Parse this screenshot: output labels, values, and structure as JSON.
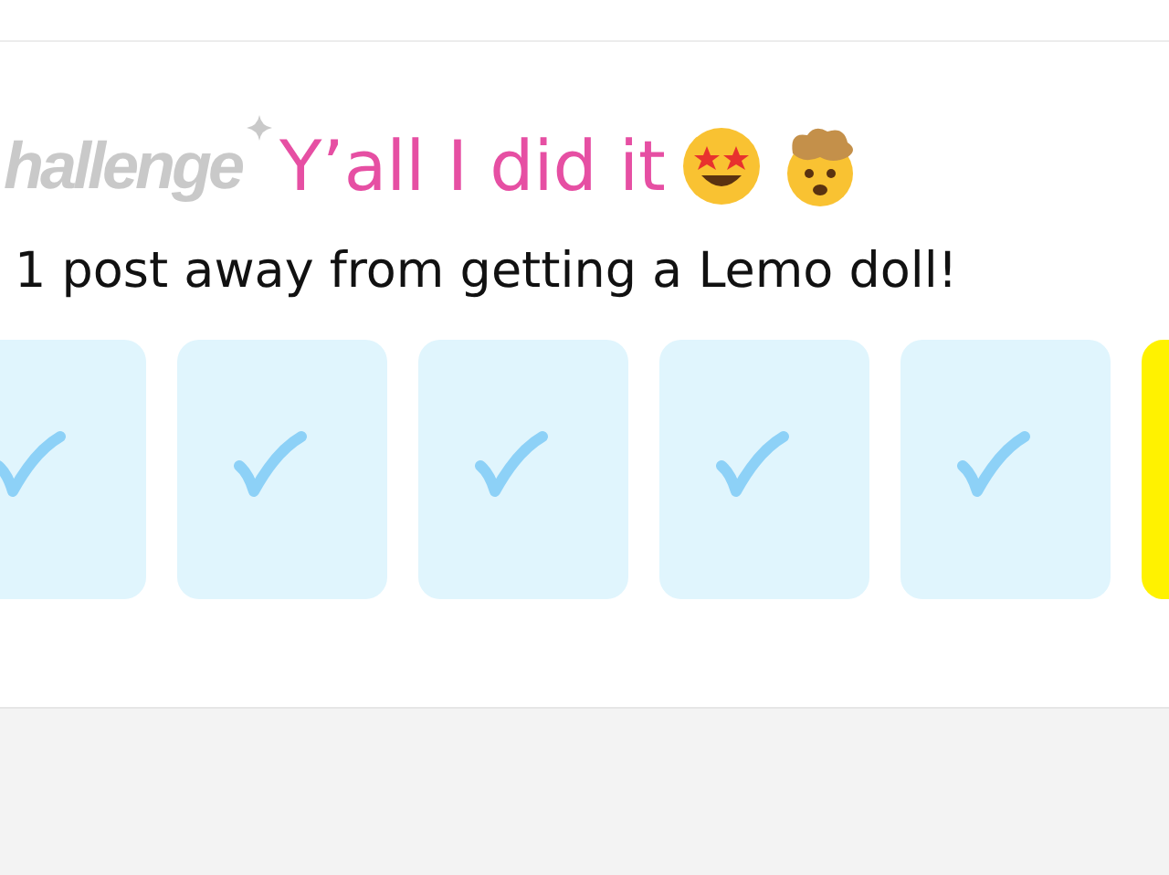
{
  "badge": "hallenge",
  "title": "Y’all I did it",
  "subtitle": "1 post away from getting a Lemo doll!",
  "days": [
    {
      "checked": true
    },
    {
      "checked": true
    },
    {
      "checked": true
    },
    {
      "checked": true
    },
    {
      "checked": true
    },
    {
      "checked": false
    }
  ]
}
